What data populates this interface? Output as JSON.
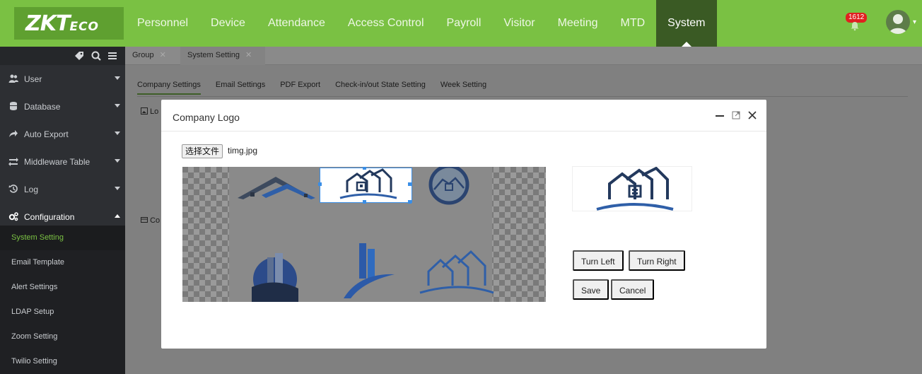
{
  "brand": {
    "logo_main": "ZKT",
    "logo_eco": "ECO"
  },
  "nav": {
    "items": [
      {
        "label": "Personnel"
      },
      {
        "label": "Device"
      },
      {
        "label": "Attendance"
      },
      {
        "label": "Access Control"
      },
      {
        "label": "Payroll"
      },
      {
        "label": "Visitor"
      },
      {
        "label": "Meeting"
      },
      {
        "label": "MTD"
      },
      {
        "label": "System",
        "active": true
      }
    ],
    "notifications": "1612",
    "accent_color": "#7ac143",
    "active_color": "#3a5a24"
  },
  "sidebar": {
    "tools": [
      "tag-icon",
      "search-icon",
      "list-icon"
    ],
    "items": [
      {
        "label": "User",
        "icon": "users-icon"
      },
      {
        "label": "Database",
        "icon": "database-icon"
      },
      {
        "label": "Auto Export",
        "icon": "share-arrow-icon"
      },
      {
        "label": "Middleware Table",
        "icon": "swap-arrows-icon"
      },
      {
        "label": "Log",
        "icon": "history-icon"
      },
      {
        "label": "Configuration",
        "icon": "gears-icon",
        "expanded": true
      }
    ],
    "subitems": [
      {
        "label": "System Setting",
        "active": true
      },
      {
        "label": "Email Template"
      },
      {
        "label": "Alert Settings"
      },
      {
        "label": "LDAP Setup"
      },
      {
        "label": "Zoom Setting"
      },
      {
        "label": "Twilio Setting"
      }
    ]
  },
  "page_tabs": [
    {
      "label": "Group"
    },
    {
      "label": "System Setting",
      "active": true
    }
  ],
  "settings_tabs": [
    {
      "label": "Company Settings",
      "active": true
    },
    {
      "label": "Email Settings"
    },
    {
      "label": "PDF Export"
    },
    {
      "label": "Check-in/out State Setting"
    },
    {
      "label": "Week Setting"
    }
  ],
  "background_fragments": {
    "lo": "Lo",
    "co": "Co"
  },
  "modal": {
    "title": "Company Logo",
    "file_button": "选择文件",
    "file_name": "timg.jpg",
    "buttons": {
      "turn_left": "Turn Left",
      "turn_right": "Turn Right",
      "save": "Save",
      "cancel": "Cancel"
    },
    "logo_blue": "#2f5fa8",
    "logo_dark": "#23395d"
  }
}
